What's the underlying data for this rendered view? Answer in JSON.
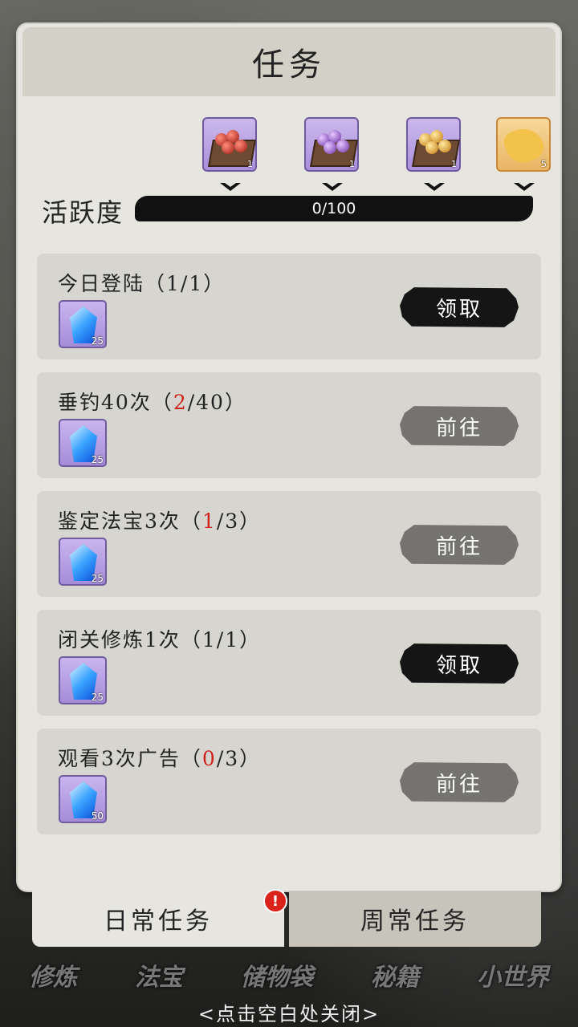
{
  "header": {
    "title": "任务"
  },
  "activity": {
    "label": "活跃度",
    "value_text": "0/100",
    "progress": 0
  },
  "milestone_rewards": [
    {
      "icon": "red-orbs-tray-icon",
      "count": "1"
    },
    {
      "icon": "purple-orbs-tray-icon",
      "count": "1"
    },
    {
      "icon": "gold-orbs-tray-icon",
      "count": "1"
    },
    {
      "icon": "golden-scroll-icon",
      "count": "5"
    }
  ],
  "tasks": [
    {
      "title": "今日登陆（1/1）",
      "reward_icon": "blue-gem-icon",
      "reward_count": "25",
      "button": "领取",
      "state": "claim"
    },
    {
      "title_pre": "垂钓40次（",
      "progress": "2",
      "title_post": "/40）",
      "reward_icon": "blue-gem-icon",
      "reward_count": "25",
      "button": "前往",
      "state": "goto"
    },
    {
      "title_pre": "鉴定法宝3次（",
      "progress": "1",
      "title_post": "/3）",
      "reward_icon": "blue-gem-icon",
      "reward_count": "25",
      "button": "前往",
      "state": "goto"
    },
    {
      "title": "闭关修炼1次（1/1）",
      "reward_icon": "blue-gem-icon",
      "reward_count": "25",
      "button": "领取",
      "state": "claim"
    },
    {
      "title_pre": "观看3次广告（",
      "progress": "0",
      "title_post": "/3）",
      "reward_icon": "blue-gem-icon",
      "reward_count": "50",
      "button": "前往",
      "state": "goto"
    }
  ],
  "tabs": {
    "daily": "日常任务",
    "weekly": "周常任务",
    "alert": "!"
  },
  "bottom_nav": [
    "修炼",
    "法宝",
    "储物袋",
    "秘籍",
    "小世界"
  ],
  "close_hint": "<点击空白处关闭>",
  "colors": {
    "panel": "#e6e5df",
    "card": "#d6d5cf",
    "claim_button": "#151515",
    "goto_button": "#747370",
    "progress_red": "#d0201a"
  }
}
